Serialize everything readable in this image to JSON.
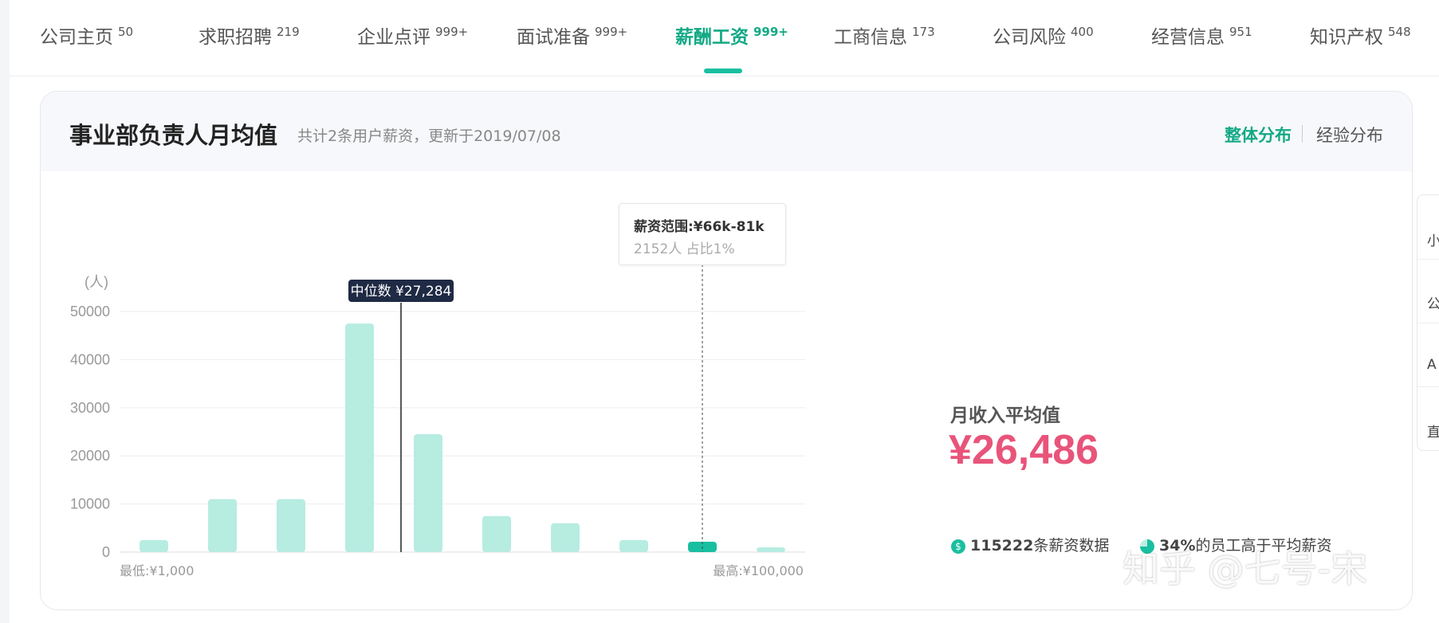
{
  "nav": {
    "tabs": [
      {
        "label": "公司主页",
        "count": "50"
      },
      {
        "label": "求职招聘",
        "count": "219"
      },
      {
        "label": "企业点评",
        "count": "999+"
      },
      {
        "label": "面试准备",
        "count": "999+"
      },
      {
        "label": "薪酬工资",
        "count": "999+",
        "active": true
      },
      {
        "label": "工商信息",
        "count": "173"
      },
      {
        "label": "公司风险",
        "count": "400"
      },
      {
        "label": "经营信息",
        "count": "951"
      },
      {
        "label": "知识产权",
        "count": "548"
      }
    ]
  },
  "card": {
    "title": "事业部负责人月均值",
    "subtitle": "共计2条用户薪资，更新于2019/07/08",
    "toggle_overall": "整体分布",
    "toggle_experience": "经验分布"
  },
  "chart_data": {
    "type": "bar",
    "ylabel": "(人)",
    "ylim": [
      0,
      50000
    ],
    "yticks": [
      0,
      10000,
      20000,
      30000,
      40000,
      50000
    ],
    "values": [
      2500,
      11000,
      11000,
      47500,
      24500,
      7500,
      6000,
      2500,
      2152,
      1000
    ],
    "highlight_index": 8,
    "x_min_label": "最低:¥1,000",
    "x_max_label": "最高:¥100,000",
    "median_label": "中位数 ¥27,284",
    "median_position": 4.0,
    "tooltip": {
      "title": "薪资范围:¥66k-81k",
      "line": "2152人  占比1%"
    },
    "colors": {
      "bar": "#b7ece1",
      "highlight": "#19bfa0",
      "grid": "#eeeeee",
      "median": "#222222"
    }
  },
  "summary": {
    "avg_label": "月收入平均值",
    "avg_value": "¥26,486",
    "records_count": "115222",
    "records_suffix": "条薪资数据",
    "above_pct": "34%",
    "above_suffix": "的员工高于平均薪资"
  },
  "watermark": "知乎 @七号-宋",
  "side_panel": {
    "items": [
      "小",
      "公",
      "A",
      "直"
    ]
  },
  "colors": {
    "accent": "#13a985",
    "avg": "#e8547a"
  }
}
